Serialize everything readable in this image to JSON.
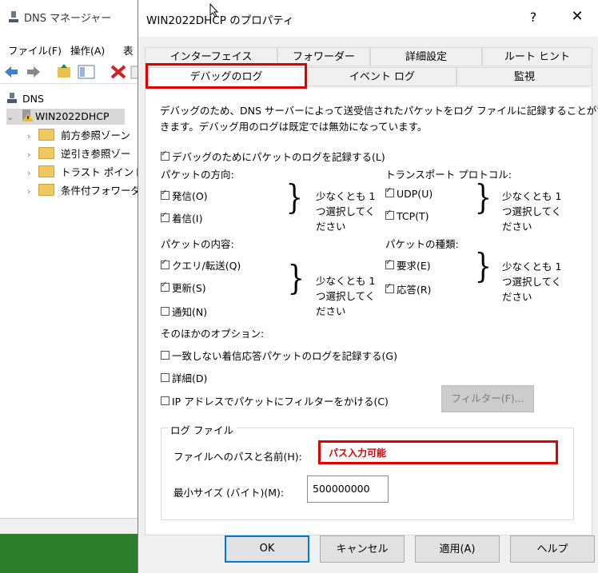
{
  "background_app": {
    "title": "DNS マネージャー",
    "menu": [
      "ファイル(F)",
      "操作(A)",
      "表"
    ],
    "tree": {
      "root": "DNS",
      "server": "WIN2022DHCP",
      "children": [
        "前方参照ゾーン",
        "逆引き参照ゾー",
        "トラスト ポイント",
        "条件付フォワーダ"
      ]
    }
  },
  "dialog": {
    "title": "WIN2022DHCP のプロパティ",
    "help_label": "?",
    "close_label": "✕",
    "tabs_row1": [
      "インターフェイス",
      "フォワーダー",
      "詳細設定",
      "ルート ヒント"
    ],
    "tabs_row2": [
      "デバッグのログ",
      "イベント ログ",
      "監視"
    ],
    "active_tab": "デバッグのログ",
    "description_line1": "デバッグのため、DNS サーバーによって送受信されたパケットをログ ファイルに記録することがで",
    "description_line2": "きます。デバッグ用のログは既定では無効になっています。",
    "enable_logging": {
      "label": "デバッグのためにパケットのログを記録する(L)",
      "checked": true
    },
    "direction": {
      "heading": "パケットの方向:",
      "options": [
        {
          "label": "発信(O)",
          "checked": true
        },
        {
          "label": "着信(I)",
          "checked": true
        }
      ],
      "note": "少なくとも 1 つ選択してください"
    },
    "transport": {
      "heading": "トランスポート プロトコル:",
      "options": [
        {
          "label": "UDP(U)",
          "checked": true
        },
        {
          "label": "TCP(T)",
          "checked": true
        }
      ],
      "note": "少なくとも 1 つ選択してください"
    },
    "contents": {
      "heading": "パケットの内容:",
      "options": [
        {
          "label": "クエリ/転送(Q)",
          "checked": true
        },
        {
          "label": "更新(S)",
          "checked": true
        },
        {
          "label": "通知(N)",
          "checked": false
        }
      ],
      "note": "少なくとも 1 つ選択してください"
    },
    "packet_type": {
      "heading": "パケットの種類:",
      "options": [
        {
          "label": "要求(E)",
          "checked": true
        },
        {
          "label": "応答(R)",
          "checked": true
        }
      ],
      "note": "少なくとも 1 つ選択してください"
    },
    "other_options": {
      "heading": "そのほかのオプション:",
      "options": [
        {
          "label": "一致しない着信応答パケットのログを記録する(G)",
          "checked": false
        },
        {
          "label": "詳細(D)",
          "checked": false
        },
        {
          "label": "IP アドレスでパケットにフィルターをかける(C)",
          "checked": false
        }
      ]
    },
    "filter_button": "フィルター(F)...",
    "log_file": {
      "legend": "ログ ファイル",
      "path_label": "ファイルへのパスと名前(H):",
      "path_value": "パス入力可能",
      "size_label": "最小サイズ (バイト)(M):",
      "size_value": "500000000"
    },
    "buttons": {
      "ok": "OK",
      "cancel": "キャンセル",
      "apply": "適用(A)",
      "help": "ヘルプ"
    }
  },
  "colors": {
    "highlight": "#e00000",
    "default_button_border": "#0078d7",
    "taskbar": "#2d7d2d"
  }
}
